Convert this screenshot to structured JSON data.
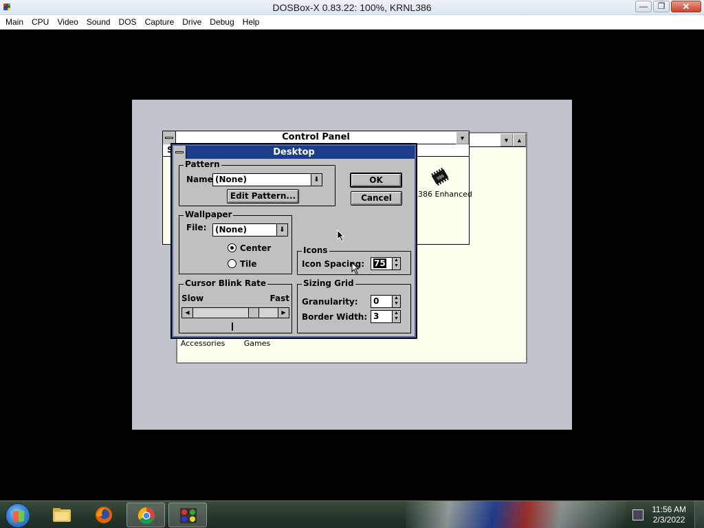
{
  "host": {
    "title": "DOSBox-X 0.83.22: 100%, KRNL386",
    "minimize_glyph": "—",
    "maximize_glyph": "❐",
    "close_glyph": "✕",
    "menu": [
      "Main",
      "CPU",
      "Video",
      "Sound",
      "DOS",
      "Capture",
      "Drive",
      "Debug",
      "Help"
    ]
  },
  "control_panel": {
    "title": "Control Panel",
    "menu_fragment": "S",
    "icon_label": "386 Enhanced"
  },
  "program_manager": {
    "groups": [
      "Accessories",
      "Games"
    ]
  },
  "dialog": {
    "title": "Desktop",
    "pattern": {
      "group_label": "Pattern",
      "name_label": "Name:",
      "name_value": "(None)",
      "edit_button": "Edit Pattern..."
    },
    "wallpaper": {
      "group_label": "Wallpaper",
      "file_label": "File:",
      "file_value": "(None)",
      "center_label": "Center",
      "tile_label": "Tile",
      "selected": "Center"
    },
    "buttons": {
      "ok": "OK",
      "cancel": "Cancel"
    },
    "icons": {
      "group_label": "Icons",
      "spacing_label": "Icon Spacing:",
      "spacing_value": "75"
    },
    "cursor_blink": {
      "group_label": "Cursor Blink Rate",
      "slow_label": "Slow",
      "fast_label": "Fast",
      "rate": 0.75
    },
    "sizing_grid": {
      "group_label": "Sizing Grid",
      "granularity_label": "Granularity:",
      "granularity_value": "0",
      "border_label": "Border Width:",
      "border_value": "3"
    }
  },
  "taskbar": {
    "apps": [
      "start-menu",
      "file-explorer",
      "firefox",
      "chrome",
      "dosbox"
    ],
    "clock_time": "11:56 AM",
    "clock_date": "2/3/2022"
  },
  "colors": {
    "dialog_title_bg": "#1c3e8a",
    "win31_face": "#c0c0c0",
    "window_bg": "#fffff0",
    "desktop_bg": "#c0c4cc"
  }
}
